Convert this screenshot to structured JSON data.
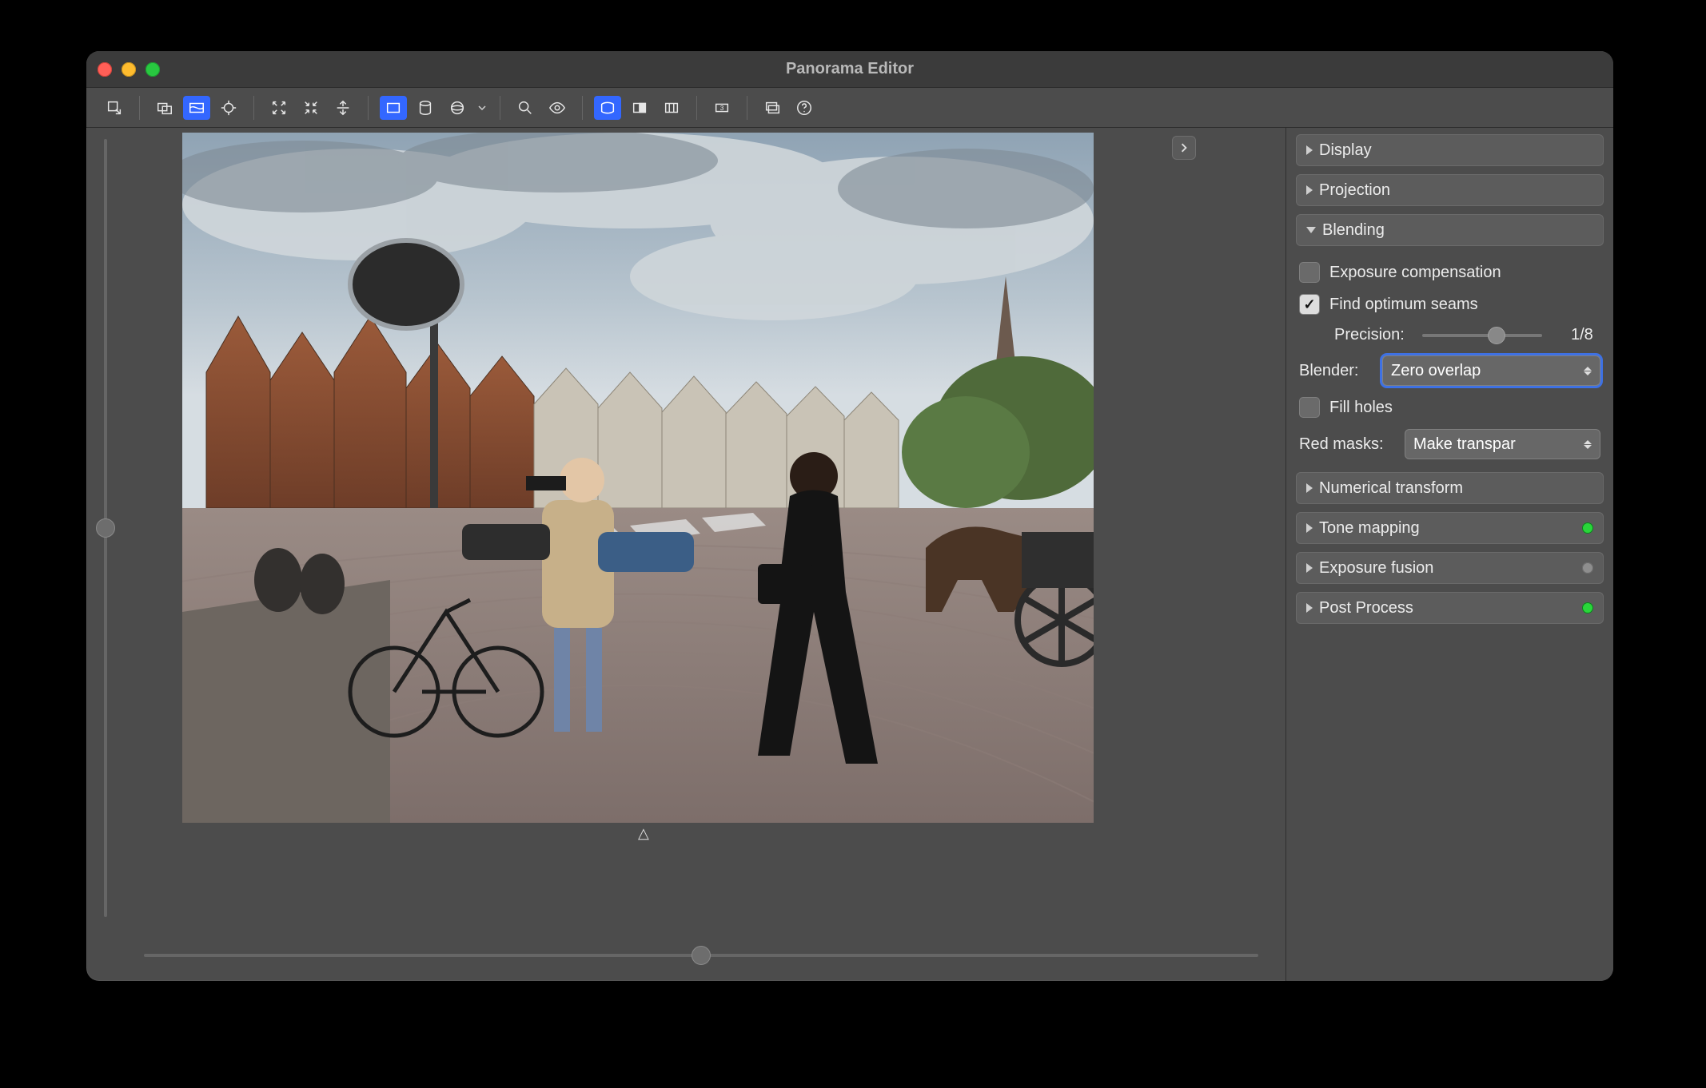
{
  "window": {
    "title": "Panorama Editor"
  },
  "toolbar": {
    "group1": [
      "selection-cursor-icon"
    ],
    "group2": [
      "layout-overlap-icon",
      "layout-panorama-icon",
      "target-icon"
    ],
    "group3": [
      "expand-icon",
      "contract-icon",
      "fit-vert-icon"
    ],
    "group4": [
      "projection-rect-icon",
      "projection-cylinder-icon",
      "projection-sphere-icon"
    ],
    "group4_active_index": 0,
    "group4_has_dropdown": true,
    "group5": [
      "search-zoom-icon",
      "eye-icon"
    ],
    "group6": [
      "crop-outline-icon",
      "halftone-icon",
      "grid-icon"
    ],
    "group6_active_index": 0,
    "group7": [
      "thumbnail-3-icon"
    ],
    "group8": [
      "window-stack-icon",
      "help-icon"
    ]
  },
  "panels": {
    "display": {
      "label": "Display",
      "expanded": false
    },
    "projection": {
      "label": "Projection",
      "expanded": false
    },
    "blending": {
      "label": "Blending",
      "expanded": true,
      "exposure_comp": {
        "label": "Exposure compensation",
        "checked": false
      },
      "find_seams": {
        "label": "Find optimum seams",
        "checked": true
      },
      "precision": {
        "label": "Precision:",
        "value": "1/8",
        "pos": 0.62
      },
      "blender": {
        "label": "Blender:",
        "value": "Zero overlap",
        "focused": true
      },
      "fill_holes": {
        "label": "Fill holes",
        "checked": false
      },
      "red_masks": {
        "label": "Red masks:",
        "value": "Make transparent"
      }
    },
    "numerical": {
      "label": "Numerical transform",
      "expanded": false
    },
    "tone": {
      "label": "Tone mapping",
      "expanded": false,
      "status": "green"
    },
    "fusion": {
      "label": "Exposure fusion",
      "expanded": false,
      "status": "gray"
    },
    "post": {
      "label": "Post Process",
      "expanded": false,
      "status": "green"
    }
  },
  "preview": {
    "yaw_marker": "△"
  }
}
